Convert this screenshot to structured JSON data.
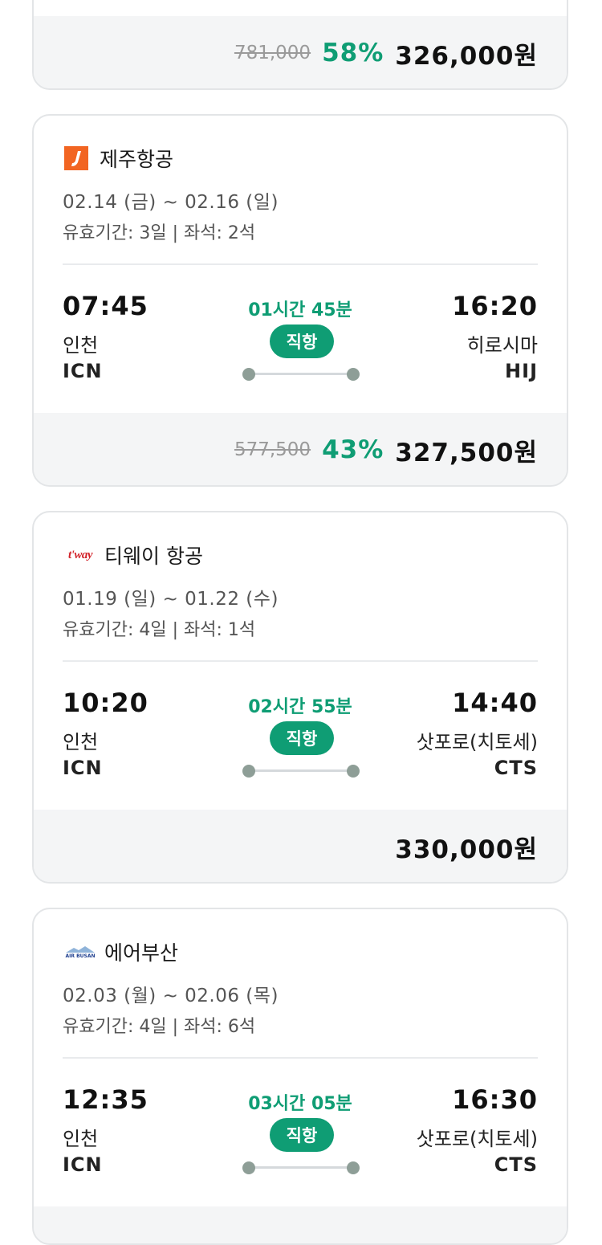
{
  "top_card": {
    "original_price": "781,000",
    "discount": "58%",
    "final_price": "326,000원"
  },
  "flights": [
    {
      "airline": "제주항공",
      "logo_icon": "jeju-air-logo-icon",
      "dates": "02.14 (금) ~ 02.16 (일)",
      "validity": "유효기간: 3일 | 좌석: 2석",
      "dep_time": "07:45",
      "dep_city": "인천",
      "dep_code": "ICN",
      "duration": "01시간 45분",
      "direct_label": "직항",
      "arr_time": "16:20",
      "arr_city": "히로시마",
      "arr_code": "HIJ",
      "original_price": "577,500",
      "discount": "43%",
      "final_price": "327,500원"
    },
    {
      "airline": "티웨이 항공",
      "logo_icon": "tway-logo-icon",
      "dates": "01.19 (일) ~ 01.22 (수)",
      "validity": "유효기간: 4일 | 좌석: 1석",
      "dep_time": "10:20",
      "dep_city": "인천",
      "dep_code": "ICN",
      "duration": "02시간 55분",
      "direct_label": "직항",
      "arr_time": "14:40",
      "arr_city": "삿포로(치토세)",
      "arr_code": "CTS",
      "final_price": "330,000원"
    },
    {
      "airline": "에어부산",
      "logo_icon": "air-busan-logo-icon",
      "dates": "02.03 (월) ~ 02.06 (목)",
      "validity": "유효기간: 4일 | 좌석: 6석",
      "dep_time": "12:35",
      "dep_city": "인천",
      "dep_code": "ICN",
      "duration": "03시간 05분",
      "direct_label": "직항",
      "arr_time": "16:30",
      "arr_city": "삿포로(치토세)",
      "arr_code": "CTS"
    }
  ],
  "logo_text": {
    "tway": "t'way",
    "air_busan": "AIR BUSAN"
  },
  "colors": {
    "accent_green": "#0f9d74",
    "jeju_orange": "#f26522",
    "tway_red": "#d2232a",
    "air_busan_blue": "#1f3f8f"
  }
}
